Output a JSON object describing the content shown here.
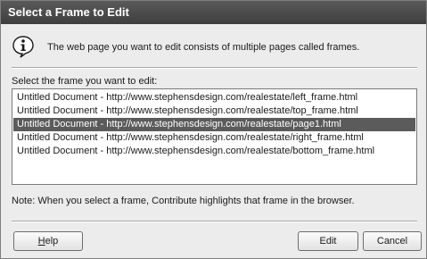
{
  "window": {
    "title": "Select a Frame to Edit"
  },
  "info": {
    "icon": "info-icon",
    "message": "The web page you want to edit consists of multiple pages called frames."
  },
  "list": {
    "label": "Select the frame you want to edit:",
    "items": [
      "Untitled Document - http://www.stephensdesign.com/realestate/left_frame.html",
      "Untitled Document - http://www.stephensdesign.com/realestate/top_frame.html",
      "Untitled Document - http://www.stephensdesign.com/realestate/page1.html",
      "Untitled Document - http://www.stephensdesign.com/realestate/right_frame.html",
      "Untitled Document - http://www.stephensdesign.com/realestate/bottom_frame.html"
    ],
    "selected_index": 2
  },
  "note": "Note: When you select a frame, Contribute highlights that frame in the browser.",
  "buttons": {
    "help_mnemonic": "H",
    "help_rest": "elp",
    "edit": "Edit",
    "cancel": "Cancel"
  },
  "colors": {
    "selection": "#5b5b5b",
    "titlebar": "#4a4a4a"
  }
}
